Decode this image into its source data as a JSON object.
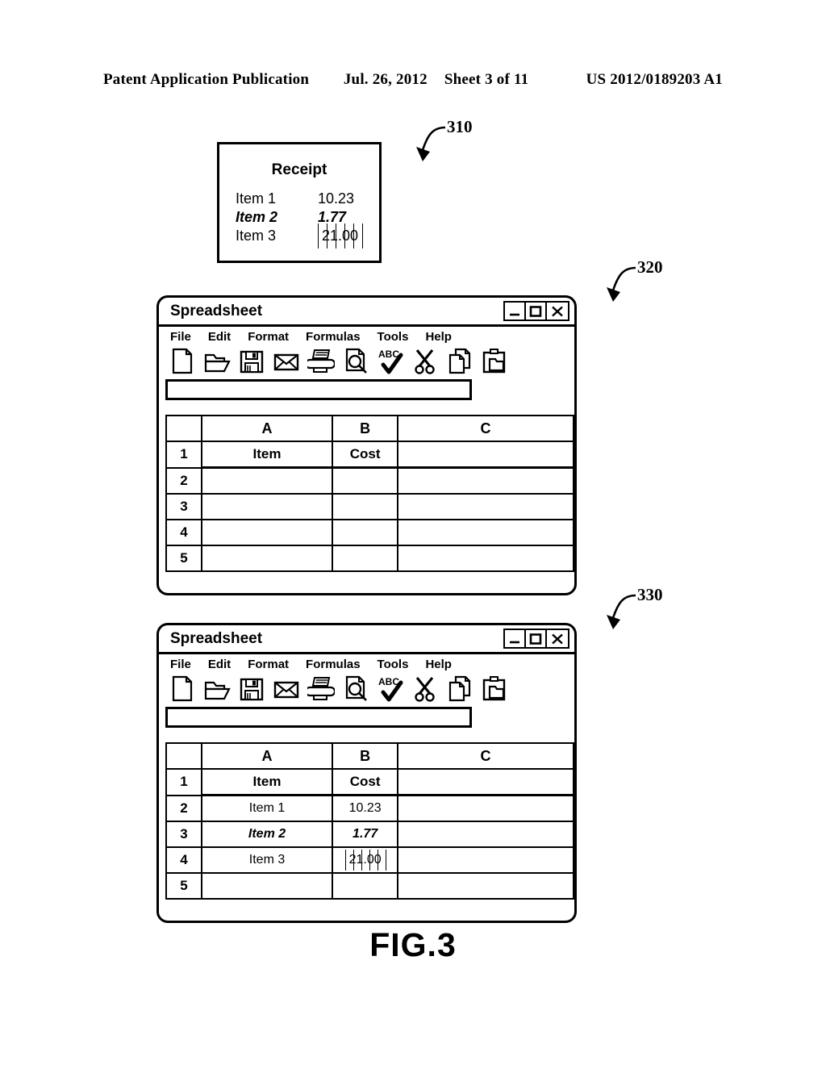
{
  "header": {
    "publication": "Patent Application Publication",
    "date": "Jul. 26, 2012",
    "sheet": "Sheet 3 of 11",
    "number": "US 2012/0189203 A1"
  },
  "figure_label": "FIG.3",
  "callouts": {
    "receipt": "310",
    "spreadsheet_empty": "320",
    "spreadsheet_filled": "330"
  },
  "receipt": {
    "title": "Receipt",
    "rows": [
      {
        "label": "Item 1",
        "amount": "10.23",
        "style": "normal"
      },
      {
        "label": "Item 2",
        "amount": "1.77",
        "style": "bold-italic"
      },
      {
        "label": "Item 3",
        "amount": "21.00",
        "style": "obscured"
      }
    ]
  },
  "window": {
    "title": "Spreadsheet",
    "controls": [
      {
        "name": "minimize",
        "glyph": "_"
      },
      {
        "name": "maximize",
        "glyph": "□"
      },
      {
        "name": "close",
        "glyph": "×"
      }
    ],
    "menus": [
      "File",
      "Edit",
      "Format",
      "Formulas",
      "Tools",
      "Help"
    ],
    "toolbar_icons": [
      "new-document-icon",
      "open-folder-icon",
      "save-floppy-icon",
      "mail-envelope-icon",
      "print-icon",
      "print-preview-icon",
      "spellcheck-abc-icon",
      "cut-scissors-icon",
      "copy-icon",
      "paste-icon"
    ],
    "spellcheck_label": "ABC",
    "formula_bar_value": "",
    "formula_bar_placeholder": ""
  },
  "sheet": {
    "column_headers": [
      "A",
      "B",
      "C"
    ],
    "row_numbers": [
      "1",
      "2",
      "3",
      "4",
      "5"
    ]
  },
  "sheet_empty": {
    "rows": [
      {
        "num": "1",
        "a": "Item",
        "b": "Cost",
        "c": "",
        "style": "header"
      },
      {
        "num": "2",
        "a": "",
        "b": "",
        "c": "",
        "style": "normal"
      },
      {
        "num": "3",
        "a": "",
        "b": "",
        "c": "",
        "style": "normal"
      },
      {
        "num": "4",
        "a": "",
        "b": "",
        "c": "",
        "style": "normal"
      },
      {
        "num": "5",
        "a": "",
        "b": "",
        "c": "",
        "style": "normal"
      }
    ]
  },
  "sheet_filled": {
    "rows": [
      {
        "num": "1",
        "a": "Item",
        "b": "Cost",
        "c": "",
        "style": "header"
      },
      {
        "num": "2",
        "a": "Item 1",
        "b": "10.23",
        "c": "",
        "style": "normal"
      },
      {
        "num": "3",
        "a": "Item 2",
        "b": "1.77",
        "c": "",
        "style": "bold-italic"
      },
      {
        "num": "4",
        "a": "Item 3",
        "b": "21.00",
        "c": "",
        "style": "obscured"
      },
      {
        "num": "5",
        "a": "",
        "b": "",
        "c": "",
        "style": "normal"
      }
    ]
  },
  "colors": {
    "ink": "#000000",
    "paper": "#ffffff"
  }
}
